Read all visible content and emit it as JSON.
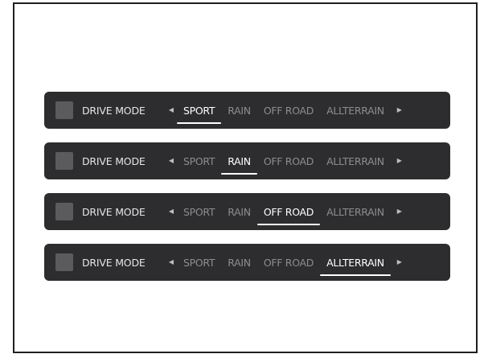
{
  "drive_mode_bars": [
    {
      "label": "DRIVE MODE",
      "options": [
        "SPORT",
        "RAIN",
        "OFF ROAD",
        "ALLTERRAIN"
      ],
      "selected": "SPORT"
    },
    {
      "label": "DRIVE MODE",
      "options": [
        "SPORT",
        "RAIN",
        "OFF ROAD",
        "ALLTERRAIN"
      ],
      "selected": "RAIN"
    },
    {
      "label": "DRIVE MODE",
      "options": [
        "SPORT",
        "RAIN",
        "OFF ROAD",
        "ALLTERRAIN"
      ],
      "selected": "OFF ROAD"
    },
    {
      "label": "DRIVE MODE",
      "options": [
        "SPORT",
        "RAIN",
        "OFF ROAD",
        "ALLTERRAIN"
      ],
      "selected": "ALLTERRAIN"
    }
  ],
  "icons": {
    "prev": "chevron-left-icon",
    "next": "chevron-right-icon"
  },
  "colors": {
    "bar_background": "#2d2d2f",
    "active_text": "#ffffff",
    "inactive_text": "#8d8d8f",
    "swatch": "#5b5b5d"
  }
}
